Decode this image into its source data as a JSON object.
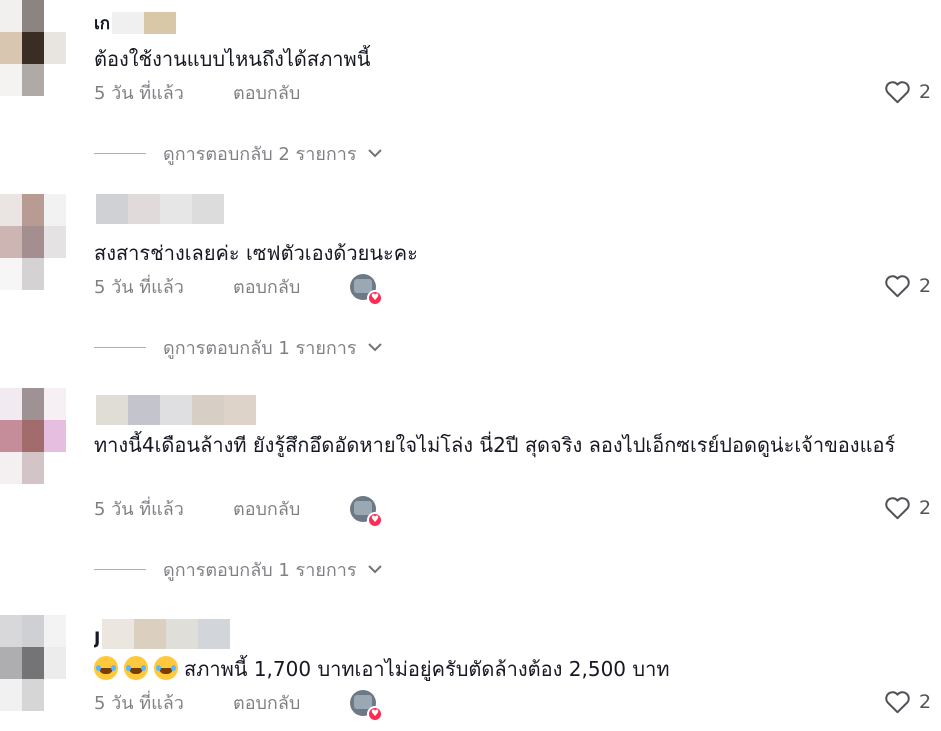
{
  "comments": [
    {
      "username_visible": "เก",
      "text": "ต้องใช้งานแบบไหนถึงได้สภาพนี้",
      "time": "5 วัน ที่แล้ว",
      "reply_label": "ตอบกลับ",
      "likes": "2",
      "creator_liked": false,
      "view_replies": "ดูการตอบกลับ 2 รายการ",
      "avatar_colors": [
        "#f2f0ef",
        "#8c8480",
        "#ffffff",
        "#d9c6b0",
        "#3a2e24",
        "#e8e4e0",
        "#f5f3f1",
        "#b0aaa6",
        "#ffffff"
      ],
      "name_colors": [
        "#f0f0f0",
        "#d8c8a8"
      ]
    },
    {
      "username_visible": "",
      "text": "สงสารช่างเลยค่ะ เซฟตัวเองด้วยนะคะ",
      "time": "5 วัน ที่แล้ว",
      "reply_label": "ตอบกลับ",
      "likes": "2",
      "creator_liked": true,
      "view_replies": "ดูการตอบกลับ 1 รายการ",
      "avatar_colors": [
        "#eae4e2",
        "#b89c94",
        "#f3f2f3",
        "#cdb5b3",
        "#a48e90",
        "#e5e2e3",
        "#f7f6f6",
        "#d5d2d4",
        "#ffffff"
      ],
      "name_colors": [
        "#cfd1d4",
        "#e0dadb",
        "#e6e6e6",
        "#dcdcdc"
      ]
    },
    {
      "username_visible": "",
      "text": "ทางนี้4เดือนล้างที ยังรู้สึกอึดอัดหายใจไม่โล่ง นี่2ปี สุดจริง ลองไปเอ็กซเรย์ปอดดูน่ะเจ้าของแอร์",
      "time": "5 วัน ที่แล้ว",
      "reply_label": "ตอบกลับ",
      "likes": "2",
      "creator_liked": true,
      "view_replies": "ดูการตอบกลับ 1 รายการ",
      "avatar_colors": [
        "#f1eaf0",
        "#9e9294",
        "#f6f0f5",
        "#c58c9a",
        "#a26c6c",
        "#e6bfe0",
        "#f4f0f2",
        "#d3c4c8",
        "#ffffff"
      ],
      "name_colors": [
        "#e0dcd6",
        "#c4c4cc",
        "#dfdfe2",
        "#d7cfc6",
        "#ded3c8"
      ]
    },
    {
      "username_visible": "J",
      "text": "สภาพนี้ 1,700 บาทเอาไม่อยู่ครับตัดล้างต้อง 2,500 บาท",
      "emoji_count": 3,
      "time": "5 วัน ที่แล้ว",
      "reply_label": "ตอบกลับ",
      "likes": "2",
      "creator_liked": true,
      "avatar_colors": [
        "#d8d8da",
        "#cfd0d3",
        "#f3f3f3",
        "#aeaeb0",
        "#747476",
        "#ececec",
        "#f1f1f1",
        "#d6d6d6",
        "#ffffff"
      ],
      "name_colors": [
        "#ebe6e0",
        "#dbcfc0",
        "#e0ded8",
        "#d2d5da"
      ]
    }
  ],
  "colors": {
    "text": "#161823",
    "muted": "rgba(22,24,35,0.55)",
    "accent_heart": "#fe2c55"
  }
}
